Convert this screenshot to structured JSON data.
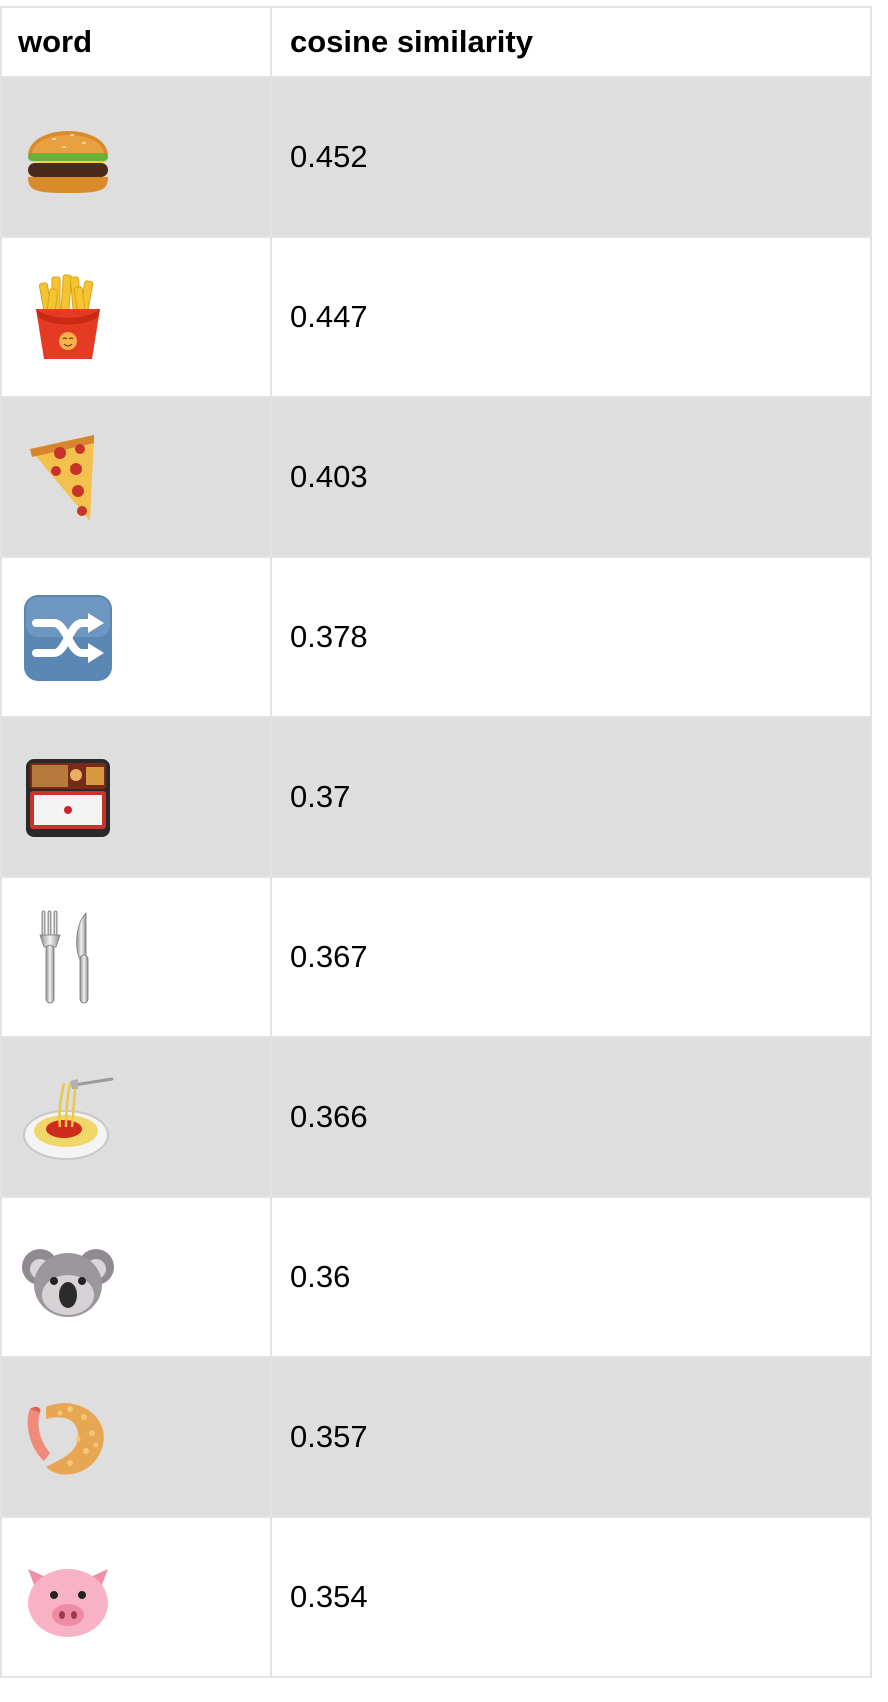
{
  "table": {
    "headers": {
      "word": "word",
      "similarity": "cosine similarity"
    },
    "rows": [
      {
        "icon": "hamburger-icon",
        "value": "0.452"
      },
      {
        "icon": "french-fries-icon",
        "value": "0.447"
      },
      {
        "icon": "pizza-slice-icon",
        "value": "0.403"
      },
      {
        "icon": "shuffle-arrows-icon",
        "value": "0.378"
      },
      {
        "icon": "bento-box-icon",
        "value": "0.37"
      },
      {
        "icon": "fork-and-knife-icon",
        "value": "0.367"
      },
      {
        "icon": "spaghetti-icon",
        "value": "0.366"
      },
      {
        "icon": "koala-icon",
        "value": "0.36"
      },
      {
        "icon": "fried-shrimp-icon",
        "value": "0.357"
      },
      {
        "icon": "pig-face-icon",
        "value": "0.354"
      }
    ]
  }
}
